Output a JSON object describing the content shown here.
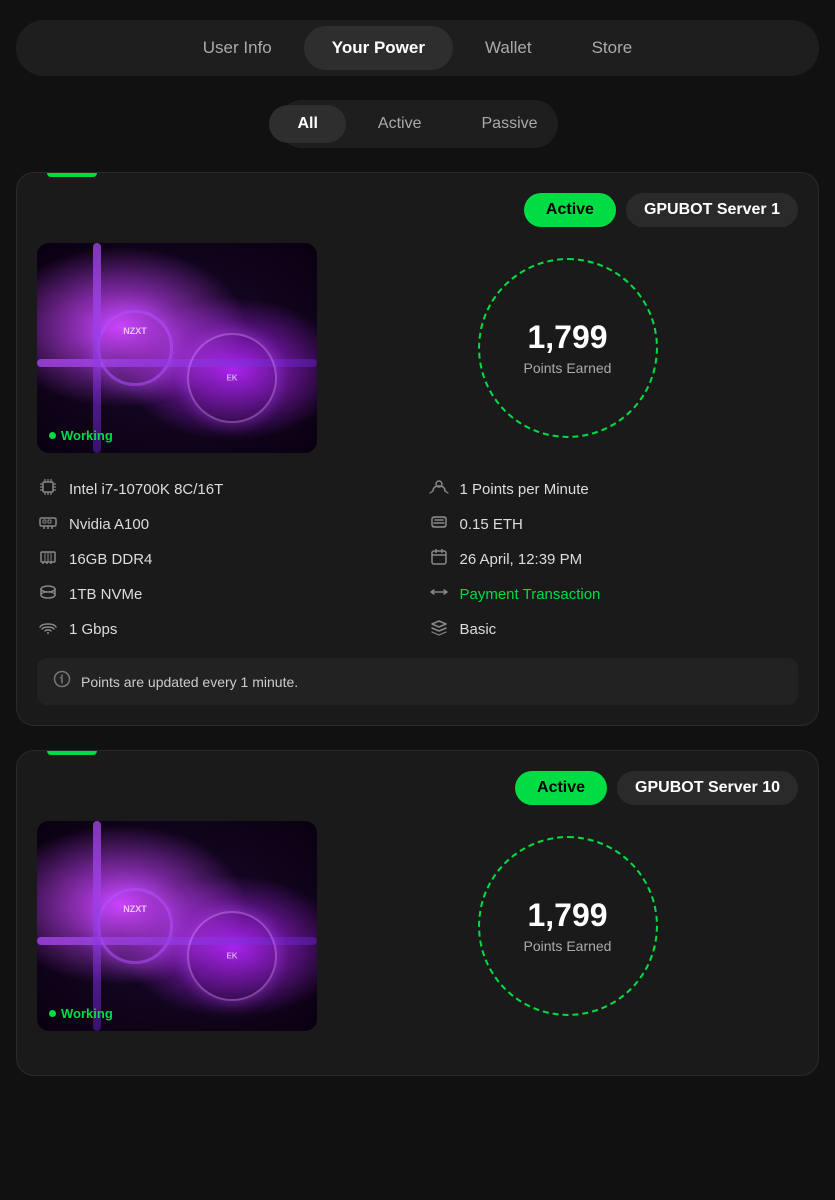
{
  "nav": {
    "tabs": [
      {
        "id": "user-info",
        "label": "User Info",
        "active": false
      },
      {
        "id": "your-power",
        "label": "Your Power",
        "active": true
      },
      {
        "id": "wallet",
        "label": "Wallet",
        "active": false
      },
      {
        "id": "store",
        "label": "Store",
        "active": false
      }
    ]
  },
  "filters": {
    "pills": [
      {
        "id": "all",
        "label": "All",
        "active": true
      },
      {
        "id": "active",
        "label": "Active",
        "active": false
      },
      {
        "id": "passive",
        "label": "Passive",
        "active": false
      }
    ]
  },
  "cards": [
    {
      "id": "card-1",
      "status": "Active",
      "server_name": "GPUBOT Server 1",
      "working_label": "Working",
      "points_earned": "1,799",
      "points_label": "Points Earned",
      "specs": [
        {
          "icon": "cpu",
          "value": "Intel i7-10700K 8C/16T"
        },
        {
          "icon": "points_rate",
          "value": "1 Points per Minute"
        },
        {
          "icon": "gpu",
          "value": "Nvidia A100"
        },
        {
          "icon": "eth",
          "value": "0.15 ETH"
        },
        {
          "icon": "ram",
          "value": "16GB DDR4"
        },
        {
          "icon": "date",
          "value": "26 April, 12:39 PM"
        },
        {
          "icon": "storage",
          "value": "1TB NVMe"
        },
        {
          "icon": "tx",
          "value": "Payment Transaction",
          "green": true
        },
        {
          "icon": "network",
          "value": "1 Gbps"
        },
        {
          "icon": "tier",
          "value": "Basic"
        }
      ],
      "notice": "Points are updated every 1 minute."
    },
    {
      "id": "card-2",
      "status": "Active",
      "server_name": "GPUBOT Server 10",
      "working_label": "Working",
      "points_earned": "1,799",
      "points_label": "Points Earned",
      "specs": [],
      "notice": ""
    }
  ],
  "icons": {
    "cpu": "⬚",
    "gpu": "▣",
    "ram": "▦",
    "storage": "⊟",
    "network": "⊛",
    "points_rate": "☁",
    "eth": "◈",
    "date": "▦",
    "tx": "⇄",
    "tier": "♛",
    "info": "💡"
  }
}
